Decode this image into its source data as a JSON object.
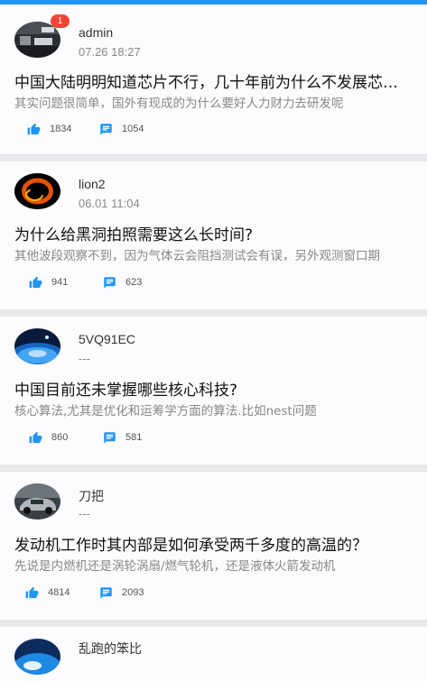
{
  "posts": [
    {
      "username": "admin",
      "time": "07.26 18:27",
      "badge": "1",
      "title": "中国大陆明明知道芯片不行，几十年前为什么不发展芯片产业？",
      "summary": "其实问题很简单，国外有现成的为什么要好人力财力去研发呢",
      "likes": "1834",
      "comments": "1054",
      "avatar_icon": "dark-office-photo"
    },
    {
      "username": "lion2",
      "time": "06.01 11:04",
      "title": "为什么给黑洞拍照需要这么长时间?",
      "summary": "其他波段观察不到，因为气体云会阻挡测试会有误，另外观测窗口期",
      "likes": "941",
      "comments": "623",
      "avatar_icon": "black-hole-photo"
    },
    {
      "username": "5VQ91EC",
      "time": "---",
      "title": "中国目前还未掌握哪些核心科技?",
      "summary": "核心算法,尤其是优化和运筹学方面的算法.比如nest问题",
      "likes": "860",
      "comments": "581",
      "avatar_icon": "blue-earth-photo"
    },
    {
      "username": "刀把",
      "time": "---",
      "title": "发动机工作时其内部是如何承受两千多度的高温的？",
      "summary": "先说是内燃机还是涡轮涡扇/燃气轮机，还是液体火箭发动机",
      "likes": "4814",
      "comments": "2093",
      "avatar_icon": "car-photo"
    },
    {
      "username": "乱跑的笨比",
      "avatar_icon": "earth-photo"
    }
  ],
  "icons": {
    "like": "thumbs-up-icon",
    "comment": "comment-icon"
  },
  "colors": {
    "accent": "#2196f3",
    "badge": "#f44336",
    "background": "#e9e9ec"
  }
}
